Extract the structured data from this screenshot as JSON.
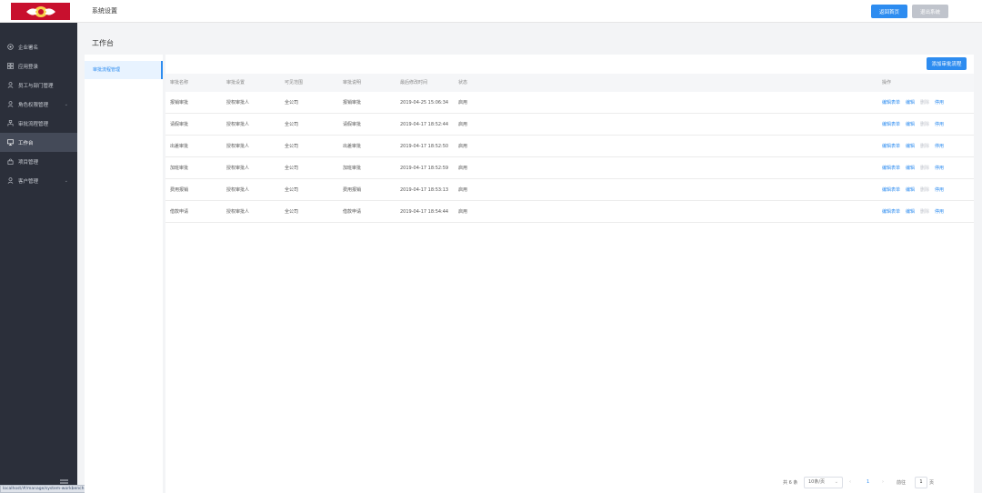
{
  "header": {
    "title": "系统设置",
    "home_button": "返回首页",
    "exit_button": "退出系统",
    "colors": {
      "brand_red": "#c8102e",
      "accent": "#2d8cf0"
    }
  },
  "sidebar": {
    "items": [
      {
        "label": "企业署名",
        "icon": "circle-icon",
        "has_chevron": false
      },
      {
        "label": "应用登录",
        "icon": "grid-icon",
        "has_chevron": false
      },
      {
        "label": "员工与部门管理",
        "icon": "user-icon",
        "has_chevron": false
      },
      {
        "label": "角色权限管理",
        "icon": "user-icon",
        "has_chevron": true
      },
      {
        "label": "审批流程管理",
        "icon": "flow-icon",
        "has_chevron": false
      },
      {
        "label": "工作台",
        "icon": "monitor-icon",
        "has_chevron": false,
        "active": true
      },
      {
        "label": "项目管理",
        "icon": "lock-icon",
        "has_chevron": false
      },
      {
        "label": "客户管理",
        "icon": "user-icon",
        "has_chevron": true
      }
    ]
  },
  "status_url": "localhost/#/manage/system-workbench",
  "page": {
    "title": "工作台"
  },
  "left_panel": {
    "item": "审批流程管理"
  },
  "main": {
    "add_button": "添加审批流程",
    "columns": [
      "审批名称",
      "审批设置",
      "可见范围",
      "审批说明",
      "最后修改时间",
      "状态",
      "操作"
    ],
    "rows": [
      {
        "name": "报销审批",
        "setting": "授权审批人",
        "scope": "全公司",
        "desc": "报销审批",
        "time": "2019-04-25 15:06:34",
        "status": "启用"
      },
      {
        "name": "请假审批",
        "setting": "授权审批人",
        "scope": "全公司",
        "desc": "请假审批",
        "time": "2019-04-17 18:52:44",
        "status": "启用"
      },
      {
        "name": "出差审批",
        "setting": "授权审批人",
        "scope": "全公司",
        "desc": "出差审批",
        "time": "2019-04-17 18:52:50",
        "status": "启用"
      },
      {
        "name": "加班审批",
        "setting": "授权审批人",
        "scope": "全公司",
        "desc": "加班审批",
        "time": "2019-04-17 18:52:59",
        "status": "启用"
      },
      {
        "name": "费用报销",
        "setting": "授权审批人",
        "scope": "全公司",
        "desc": "费用报销",
        "time": "2019-04-17 18:53:13",
        "status": "启用"
      },
      {
        "name": "借款申请",
        "setting": "授权审批人",
        "scope": "全公司",
        "desc": "借款申请",
        "time": "2019-04-17 18:54:44",
        "status": "启用"
      }
    ],
    "row_ops": [
      "编辑表单",
      "编辑",
      "删除",
      "停用"
    ],
    "pagination": {
      "total": "共 6 条",
      "page_size": "10条/页",
      "current": "1",
      "goto_label": "前往",
      "goto_value": "1",
      "page_suffix": "页"
    }
  }
}
